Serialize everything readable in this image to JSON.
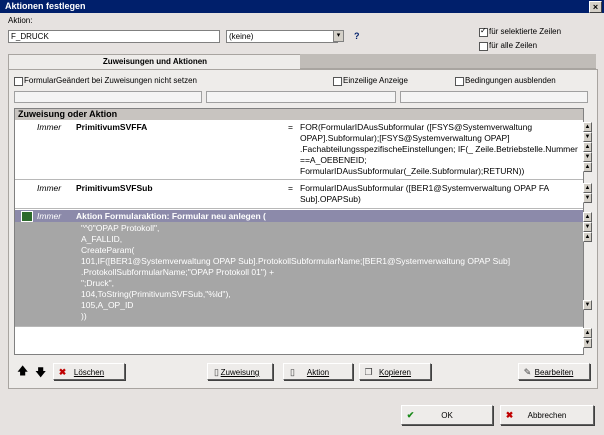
{
  "window": {
    "title": "Aktionen festlegen",
    "close": "×"
  },
  "aktion": {
    "label": "Aktion:",
    "value": "F_DRUCK",
    "keine": "(keine)",
    "dd_arrow": "▾",
    "help": "?"
  },
  "scope": {
    "selected": "für selektierte Zeilen",
    "all": "für alle Zeilen"
  },
  "tab": {
    "label": "Zuweisungen und Aktionen"
  },
  "options": {
    "formular": "FormularGeändert bei Zuweisungen nicht setzen",
    "einzeilig": "Einzeilige Anzeige",
    "bedingungen": "Bedingungen ausblenden"
  },
  "list": {
    "header": "Zuweisung oder Aktion",
    "rows": [
      {
        "when": "Immer",
        "name": "PrimitivumSVFFA",
        "eq": "=",
        "expr": "FOR(FormularIDAusSubformular ([FSYS@Systemverwaltung OPAP].Subformular);[FSYS@Systemverwaltung OPAP] .FachabteilungsspezifischeEinstellungen; IF(_ Zeile.Betriebstelle.Nummer ==A_OEBENEID; FormularIDAusSubformular(_Zeile.Subformular);RETURN))"
      },
      {
        "when": "Immer",
        "name": "PrimitivumSVFSub",
        "eq": "=",
        "expr": "FormularIDAusSubformular ([BER1@Systemverwaltung OPAP FA Sub].OPAPSub)"
      }
    ],
    "action": {
      "when": "Immer",
      "title": "Aktion Formularaktion: Formular neu anlegen (",
      "body": [
        "\"^0\"OPAP Protokoll\",",
        "A_FALLID,",
        "CreateParam(",
        "101,IF([BER1@Systemverwaltung OPAP Sub].ProtokollSubformularName;[BER1@Systemverwaltung OPAP Sub]",
        ".ProtokollSubformularName;\"OPAP Protokoll 01\") +",
        "\";Druck\",",
        "104,ToString(PrimitivumSVFSub,\"%ld\"),",
        "105,A_OP_ID",
        "))"
      ]
    }
  },
  "arrows": {
    "up": "🡅",
    "down": "🡇"
  },
  "buttons": {
    "loeschen": "Löschen",
    "zuweisung": "Zuweisung",
    "aktion": "Aktion",
    "kopieren": "Kopieren",
    "bearbeiten": "Bearbeiten",
    "ok": "OK",
    "abbrechen": "Abbrechen"
  }
}
